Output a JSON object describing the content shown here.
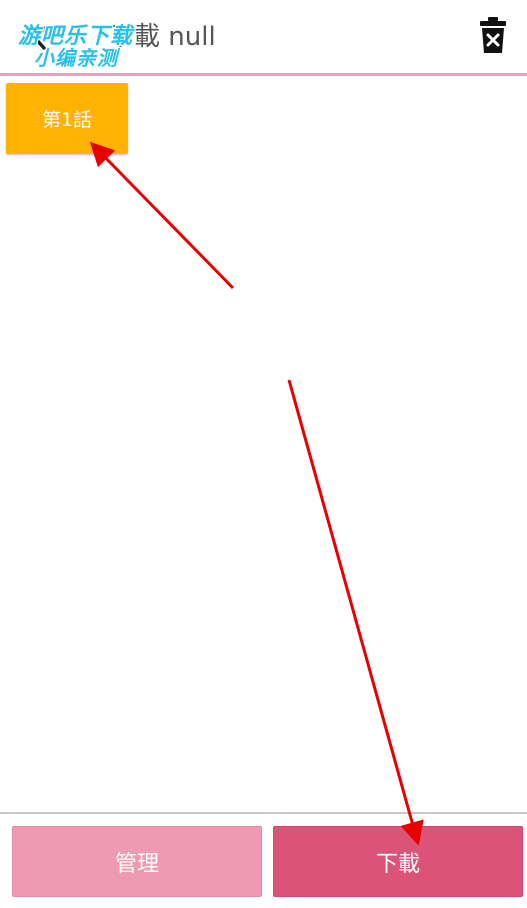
{
  "header": {
    "title": "下載 null",
    "back_icon": "back-arrow-icon",
    "delete_icon": "trash-icon"
  },
  "watermark": {
    "line1": "游吧乐下载",
    "line2": "小编亲测"
  },
  "chapters": [
    {
      "label": "第1話"
    }
  ],
  "footer": {
    "manage_label": "管理",
    "download_label": "下載"
  },
  "colors": {
    "accent": "#dc5378",
    "accent_light": "#ee9ab3",
    "chapter_bg": "#ffb300",
    "header_border": "#eaa3b7",
    "annotation_arrow": "#e60000"
  }
}
